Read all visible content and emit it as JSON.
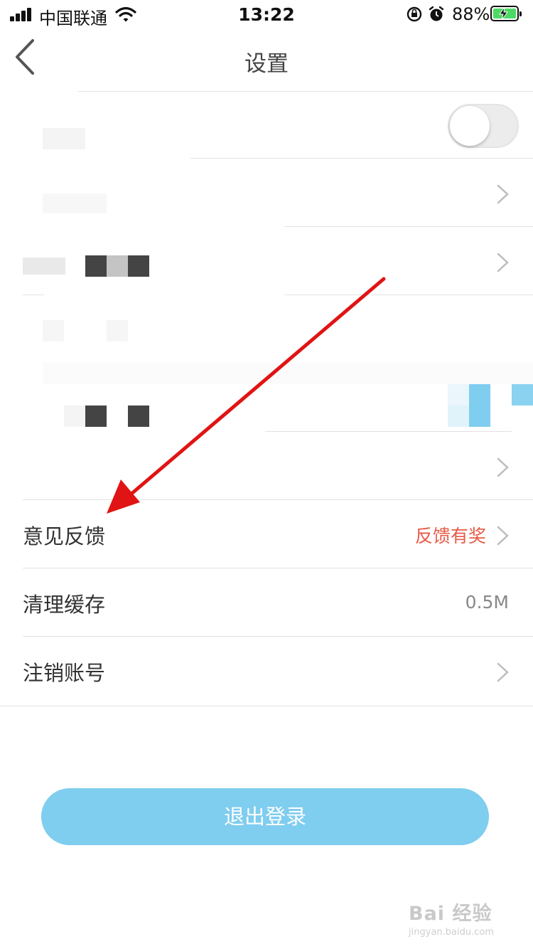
{
  "status_bar": {
    "carrier": "中国联通",
    "time": "13:22",
    "battery_percent": "88%",
    "battery_level": 0.88,
    "icons": [
      "signal-icon",
      "wifi-icon",
      "rotation-lock-icon",
      "alarm-icon",
      "battery-charging-icon"
    ]
  },
  "nav": {
    "title": "设置",
    "back_icon": "chevron-left-icon"
  },
  "rows": {
    "feedback": {
      "label": "意见反馈",
      "right_text": "反馈有奖"
    },
    "clear_cache": {
      "label": "清理缓存",
      "value": "0.5M"
    },
    "cancel_account": {
      "label": "注销账号"
    }
  },
  "toggle_state": "off",
  "logout_label": "退出登录",
  "watermark": {
    "brand": "Bai 经验",
    "url": "jingyan.baidu.com"
  },
  "colors": {
    "accent": "#7fcdef",
    "highlight_text": "#e85a47",
    "arrow": "#e01414"
  }
}
